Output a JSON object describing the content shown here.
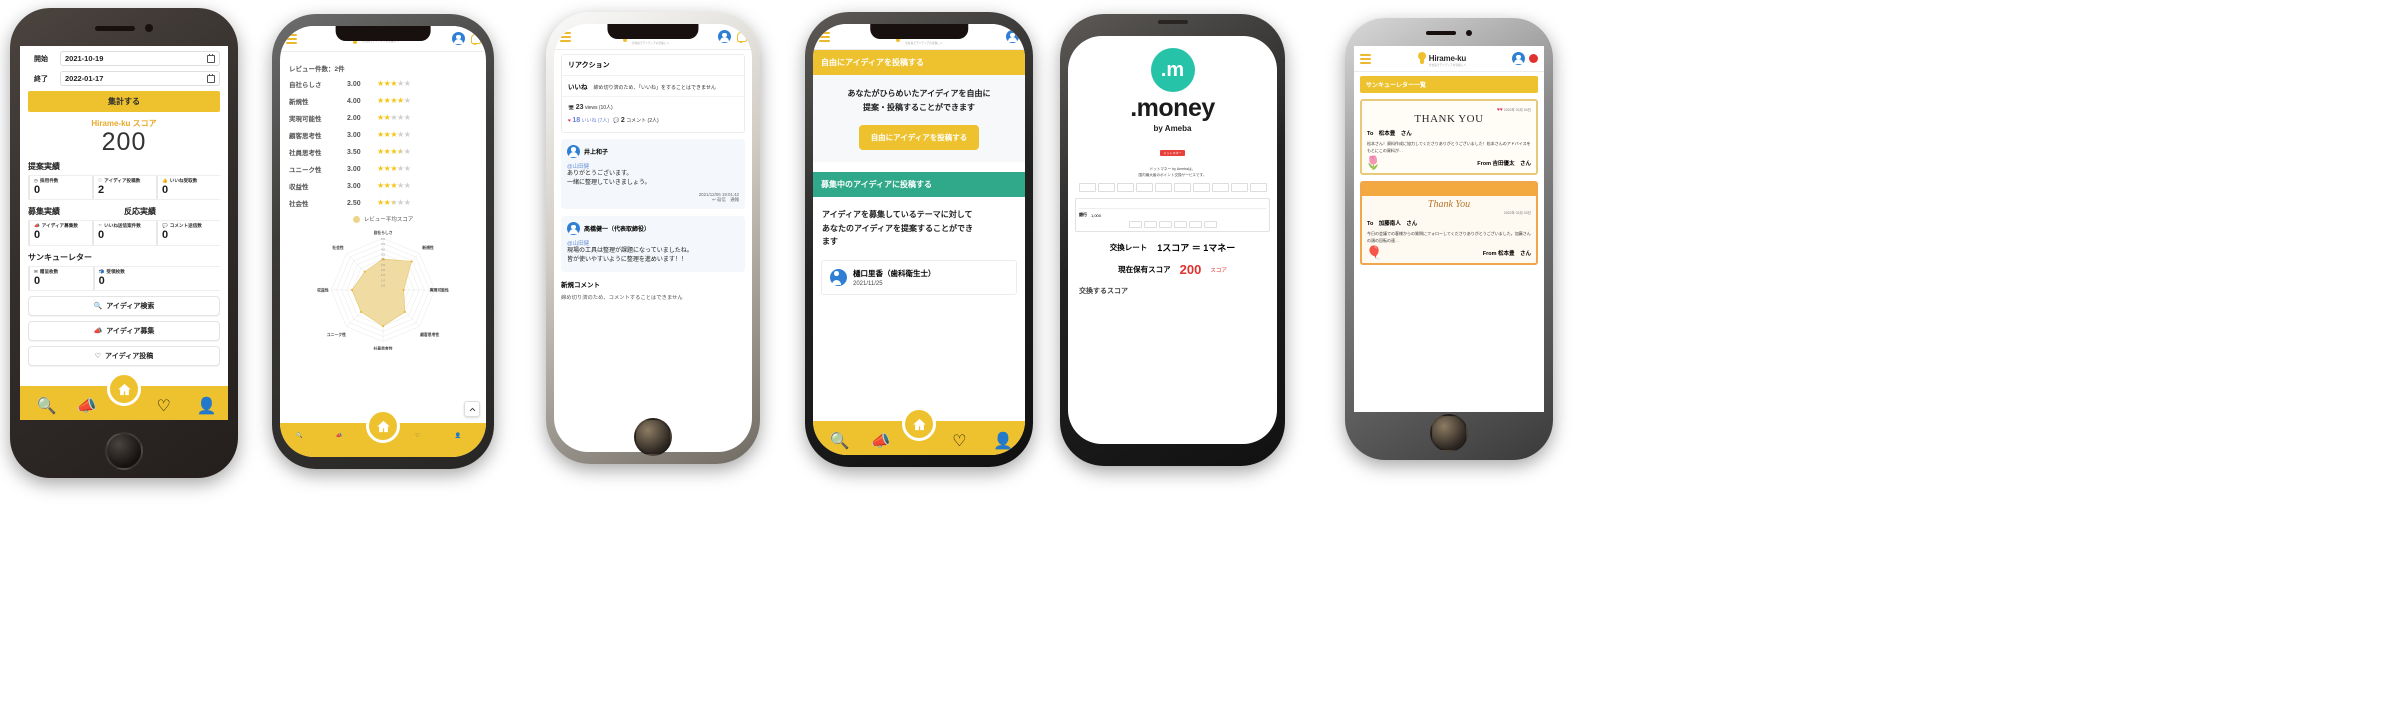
{
  "phone1": {
    "form": {
      "start_label": "開始",
      "start_value": "2021-10-19",
      "end_label": "終了",
      "end_value": "2022-01-17",
      "submit_label": "集計する"
    },
    "score": {
      "title": "Hirame-ku スコア",
      "value": "200"
    },
    "sections": [
      {
        "title": "提案実績",
        "stats": [
          {
            "label": "採用件数",
            "value": "0",
            "icon": "check-badge-icon"
          },
          {
            "label": "アイディア投稿数",
            "value": "2",
            "icon": "bulb-icon"
          },
          {
            "label": "いいね受取数",
            "value": "0",
            "icon": "thumb-up-icon"
          }
        ]
      }
    ],
    "dual": {
      "left_title": "募集実績",
      "right_title": "反応実績"
    },
    "dual_stats": [
      {
        "label": "アイディア募集数",
        "value": "0",
        "icon": "megaphone-icon"
      },
      {
        "label": "いいね送信案件数",
        "value": "0",
        "icon": "hand-icon"
      },
      {
        "label": "コメント送信数",
        "value": "0",
        "icon": "comment-icon"
      }
    ],
    "thanks": {
      "title": "サンキューレター",
      "stats": [
        {
          "label": "贈呈枚数",
          "value": "0",
          "icon": "envelope-icon"
        },
        {
          "label": "受領枚数",
          "value": "0",
          "icon": "mailbox-icon"
        }
      ]
    },
    "actions": [
      {
        "label": "アイディア検索",
        "icon": "search-icon"
      },
      {
        "label": "アイディア募集",
        "icon": "megaphone-icon"
      },
      {
        "label": "アイディア投稿",
        "icon": "bulb-icon"
      }
    ],
    "nav": [
      "search-icon",
      "megaphone-icon",
      "home-icon",
      "bulb-icon",
      "person-icon"
    ]
  },
  "phone2": {
    "brand": {
      "name": "Hirame-ku",
      "tagline": "全社員でアイディアの宝探しへ"
    },
    "review_count_label": "レビュー件数：2件",
    "reviews": [
      {
        "name": "自社らしさ",
        "score": "3.00",
        "stars": 3.0
      },
      {
        "name": "新規性",
        "score": "4.00",
        "stars": 4.0
      },
      {
        "name": "実現可能性",
        "score": "2.00",
        "stars": 2.0
      },
      {
        "name": "顧客思考性",
        "score": "3.00",
        "stars": 3.0
      },
      {
        "name": "社員思考性",
        "score": "3.50",
        "stars": 3.5
      },
      {
        "name": "ユニーク性",
        "score": "3.00",
        "stars": 3.0
      },
      {
        "name": "収益性",
        "score": "3.00",
        "stars": 3.0
      },
      {
        "name": "社会性",
        "score": "2.50",
        "stars": 2.5
      }
    ],
    "legend_label": "レビュー平均スコア",
    "chart_data": {
      "type": "radar",
      "title": "レビュー平均スコア",
      "categories": [
        "自社らしさ",
        "新規性",
        "実現可能性",
        "顧客思考性",
        "社員思考性",
        "ユニーク性",
        "収益性",
        "社会性"
      ],
      "values": [
        3.0,
        4.0,
        2.0,
        3.0,
        3.5,
        3.0,
        3.0,
        2.5
      ],
      "ticks": [
        "0.5",
        "1.0",
        "1.5",
        "2.0",
        "2.5",
        "3.0",
        "3.5",
        "4.0",
        "4.5",
        "5.0"
      ],
      "rlim": [
        0,
        5
      ],
      "series_name": "レビュー平均スコア",
      "legend_position": "top",
      "grid": true
    },
    "scroll_top_icon": "chevron-up-icon"
  },
  "phone3": {
    "reaction": {
      "title": "リアクション",
      "like_label": "いいね",
      "like_note": "締め切り済のため、「いいね」をすることはできません",
      "views": "23",
      "views_unit": "views (10人)",
      "likes": "18",
      "likes_unit": "いいね (7人)",
      "comments": "2",
      "comments_unit": "コメント (2人)"
    },
    "comments": [
      {
        "author": "井上和子",
        "mention": "@山田健",
        "body": "ありがとうございます。\n一緒に整理していきましょう。",
        "time": "2021/12/06 19:01:42",
        "actions": "返信　通報"
      },
      {
        "author": "髙橋健一（代表取締役）",
        "mention": "@山田健",
        "body": "現場の工具は整理が課題になっていましたね。\n皆が使いやすいように整理を進めいます！！",
        "time": "",
        "actions": ""
      }
    ],
    "new_comment": {
      "title": "新規コメント",
      "note": "締め切り済のため、コメントすることはできません"
    }
  },
  "phone4": {
    "free_post": {
      "banner": "自由にアイディアを投稿する",
      "description": "あなたがひらめいたアイディアを自由に\n提案・投稿することができます",
      "cta": "自由にアイディアを投稿する"
    },
    "recruit": {
      "banner": "募集中のアイディアに投稿する",
      "description": "アイディアを募集しているテーマに対して\nあなたのアイディアを提案することができ\nます"
    },
    "user": {
      "name": "樋口里香（歯科衛生士）",
      "date": "2021/11/25"
    }
  },
  "phone5": {
    "logo_mark": ".m",
    "title": ".money",
    "by_label": "by Ameba",
    "badge": "ドットマネー",
    "note": "ドットマネー by Amebaは、\n国内最大級のポイント交換サービスです。",
    "exchange": {
      "label": "交換レート",
      "value": "1スコア ＝ 1マネー"
    },
    "holdings": {
      "label": "現在保有スコア",
      "value": "200",
      "unit": "スコア"
    },
    "exchange_input_label": "交換するスコア",
    "bank_label": "銀行",
    "bank_amount": "1,000"
  },
  "phone6": {
    "header": "サンキューレター一覧",
    "letters": [
      {
        "style": "thankyou",
        "title": "THANK YOU",
        "date": "2022年 02月 04日",
        "to": "To　松本豊　さん",
        "body": "松本さん！資料作成に協力してくださりありがとうございました！松本さんのアドバイスをもとにこの資料が…",
        "from": "From 吉田優太　さん"
      },
      {
        "style": "thank-you-script",
        "title": "Thank You",
        "date": "2022年 02月 03日",
        "to": "To　加藤南人　さん",
        "body": "今日の会議での客様からの質問にフォローしてくださりありがとうございました。加藤さんの頭の回転の速…",
        "from": "From 松本豊　さん"
      }
    ]
  },
  "theme": {
    "brand_yellow": "#eec22e",
    "accent_green": "#2fa98a",
    "star_on": "#f5c518",
    "star_off": "#cfcfcf",
    "red": "#e0322e",
    "blue_avatar": "#2f7fd4"
  }
}
